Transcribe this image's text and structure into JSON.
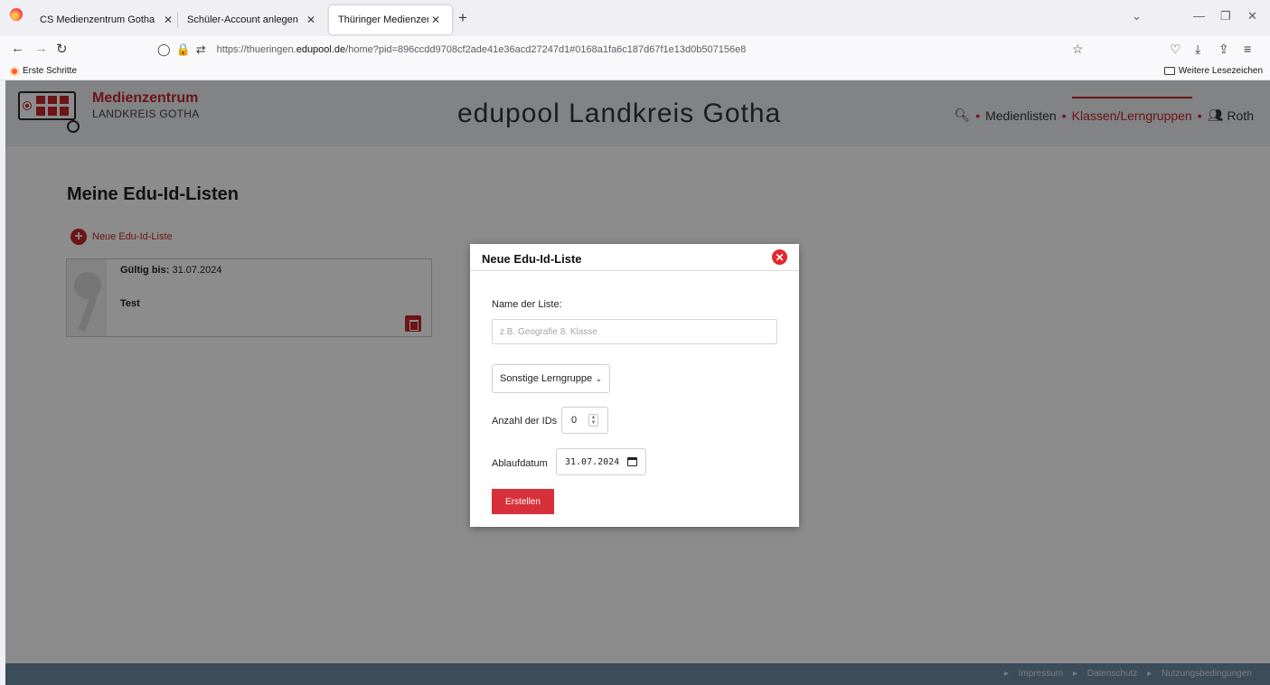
{
  "browser": {
    "tabs": [
      {
        "title": "CS Medienzentrum Gotha",
        "active": false
      },
      {
        "title": "Schüler-Account anlegen",
        "active": false
      },
      {
        "title": "Thüringer Medienzentren",
        "active": true
      }
    ],
    "url_prefix": "https://thueringen.",
    "url_domain": "edupool.de",
    "url_rest": "/home?pid=896ccdd9708cf2ade41e36acd27247d1#0168a1fa6c187d67f1e13d0b507156e8",
    "bookmark_left": "Erste Schritte",
    "bookmark_right": "Weitere Lesezeichen"
  },
  "site": {
    "logo_title": "Medienzentrum",
    "logo_subtitle": "LANDKREIS GOTHA",
    "title": "edupool Landkreis Gotha",
    "nav": {
      "media_lists": "Medienlisten",
      "classes": "Klassen/Lerngruppen",
      "user": "Roth"
    }
  },
  "content": {
    "heading": "Meine Edu-Id-Listen",
    "new_list_label": "Neue Edu-Id-Liste",
    "cards": [
      {
        "valid_label": "Gültig bis:",
        "valid_date": "31.07.2024",
        "name": "Test"
      }
    ]
  },
  "modal": {
    "title": "Neue Edu-Id-Liste",
    "name_label": "Name der Liste:",
    "name_placeholder": "z.B. Geografie 8. Klasse",
    "name_value": "",
    "group_select": "Sonstige Lerngruppe",
    "count_label": "Anzahl der IDs",
    "count_value": "0",
    "expiry_label": "Ablaufdatum",
    "expiry_value": "31.07.2024",
    "create_label": "Erstellen"
  },
  "footer": {
    "links": [
      "Impressum",
      "Datenschutz",
      "Nutzungsbedingungen"
    ]
  },
  "colors": {
    "brand_red": "#c6252b",
    "footer_blue": "#6c8aa6",
    "button_red": "#d8303a"
  }
}
